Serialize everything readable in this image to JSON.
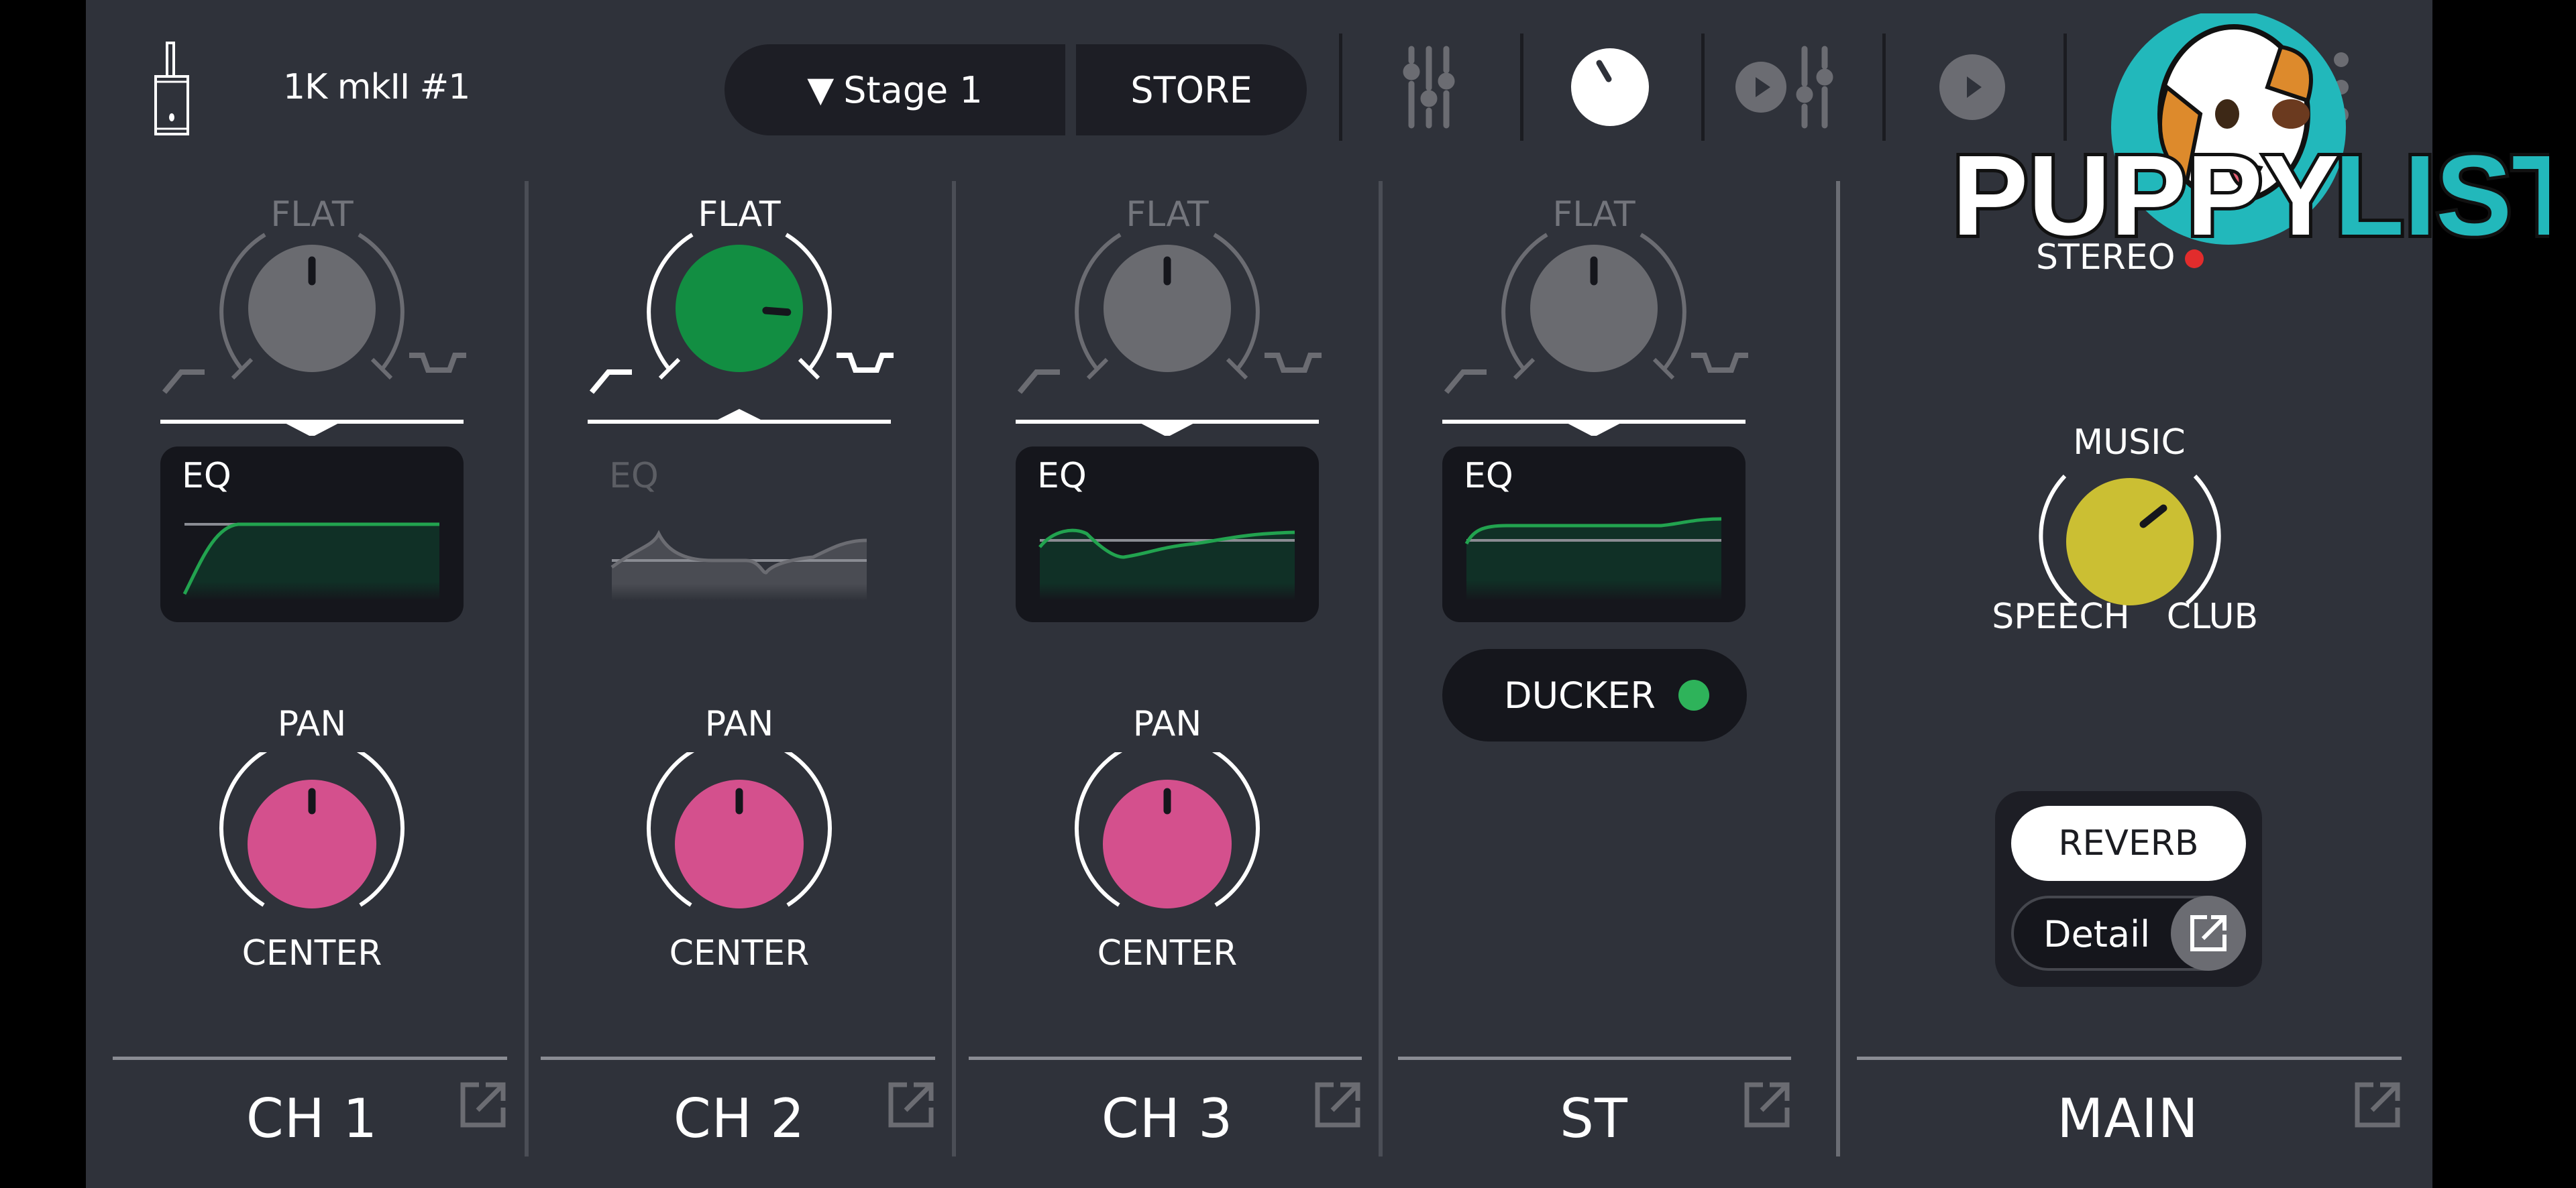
{
  "header": {
    "device_name": "1K mkII #1",
    "scene": {
      "selected": "Stage 1",
      "indicator": "▼"
    },
    "store_label": "STORE",
    "toolbar_buttons": [
      {
        "name": "mixer-faders",
        "icon": "faders-icon",
        "active": false
      },
      {
        "name": "knob-view",
        "icon": "knob-icon",
        "active": true
      },
      {
        "name": "player-mixer",
        "icon": "play-faders-icon",
        "active": false
      },
      {
        "name": "player",
        "icon": "play-icon",
        "active": false
      },
      {
        "name": "more",
        "icon": "more-icon",
        "active": false
      }
    ]
  },
  "channels": [
    {
      "name": "CH 1",
      "eq_knob": {
        "label": "FLAT",
        "value": 0.5,
        "color": "#6a6b70",
        "active": false
      },
      "eq": {
        "title": "EQ",
        "active": true,
        "curve": "lowcut"
      },
      "pan": {
        "label": "PAN",
        "value_label": "CENTER",
        "value": 0.5,
        "color": "#d4508d"
      }
    },
    {
      "name": "CH 2",
      "eq_knob": {
        "label": "FLAT",
        "value": 0.85,
        "color": "#128e42",
        "active": true
      },
      "eq": {
        "title": "EQ",
        "active": false,
        "curve": "custom"
      },
      "pan": {
        "label": "PAN",
        "value_label": "CENTER",
        "value": 0.5,
        "color": "#d4508d"
      }
    },
    {
      "name": "CH 3",
      "eq_knob": {
        "label": "FLAT",
        "value": 0.5,
        "color": "#6a6b70",
        "active": false
      },
      "eq": {
        "title": "EQ",
        "active": true,
        "curve": "wavy"
      },
      "pan": {
        "label": "PAN",
        "value_label": "CENTER",
        "value": 0.5,
        "color": "#d4508d"
      }
    },
    {
      "name": "ST",
      "eq_knob": {
        "label": "FLAT",
        "value": 0.5,
        "color": "#6a6b70",
        "active": false
      },
      "eq": {
        "title": "EQ",
        "active": true,
        "curve": "lowshelf-highboost"
      },
      "ducker": {
        "label": "DUCKER",
        "on": true,
        "color": "#2eb35a"
      }
    }
  ],
  "main": {
    "name": "MAIN",
    "stereo_label": "STEREO",
    "mode_knob": {
      "top_label": "MUSIC",
      "left_label": "SPEECH",
      "right_label": "CLUB",
      "color": "#cbbf33"
    },
    "reverb": {
      "label": "REVERB",
      "on": true
    },
    "detail_label": "Detail"
  },
  "watermark": {
    "text_left": "PUPPY",
    "text_right": "LIST"
  }
}
